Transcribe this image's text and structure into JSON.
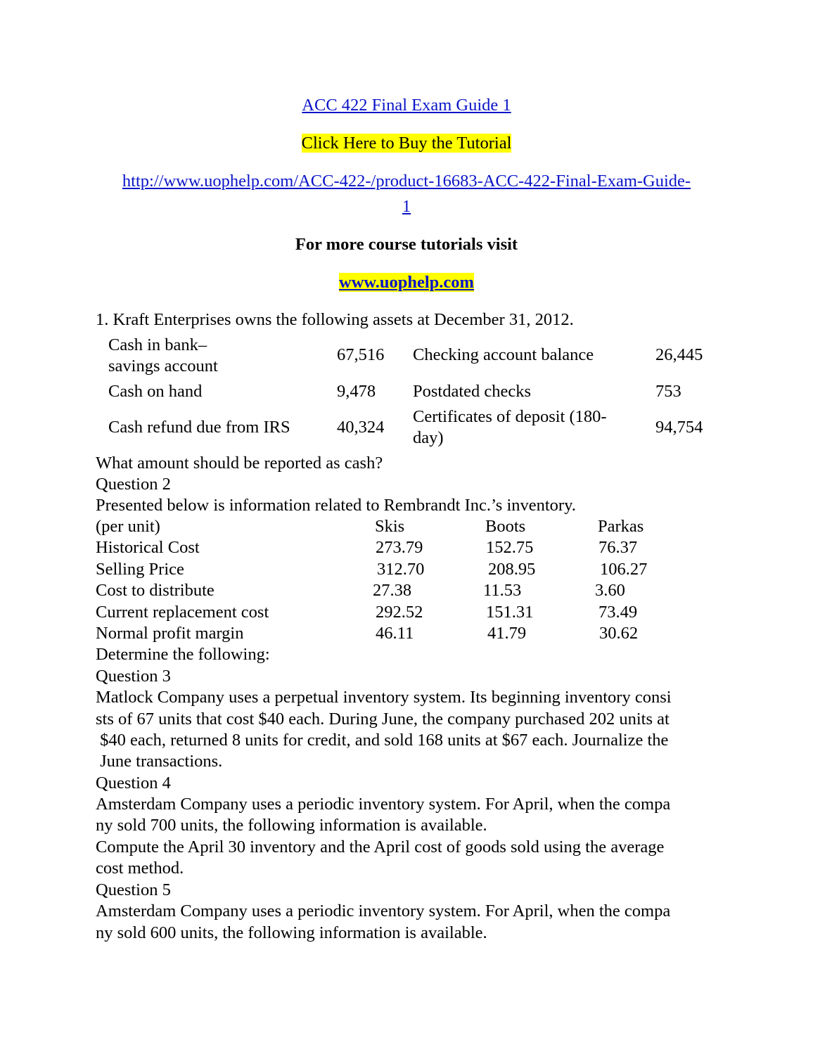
{
  "header": {
    "title_link": "ACC 422 Final Exam Guide 1",
    "buy_label": "Click Here to Buy the Tutorial",
    "url_line1": "http://www.uophelp.com/ACC-422-/product-16683-ACC-422-Final-Exam-Guide-",
    "url_line2": "1",
    "more_text": "For more course tutorials visit",
    "site_link": "www.uophelp.com"
  },
  "q1": {
    "prompt": "1. Kraft Enterprises owns the following assets at December 31, 2012.",
    "rows": [
      {
        "label_a": "Cash in bank–",
        "label_a2": "savings account",
        "value_a": "67,516",
        "label_b": "Checking account balance",
        "label_b2": "",
        "value_b": "26,445"
      },
      {
        "label_a": "Cash on hand",
        "label_a2": "",
        "value_a": "9,478",
        "label_b": "Postdated checks",
        "label_b2": "",
        "value_b": "753"
      },
      {
        "label_a": "Cash refund due from IRS",
        "label_a2": "",
        "value_a": "40,324",
        "label_b": "Certificates of deposit (180-",
        "label_b2": "day)",
        "value_b": "94,754"
      }
    ],
    "question": "What amount should be reported as cash?"
  },
  "q2": {
    "heading": "Question 2",
    "intro": "Presented below is information related to Rembrandt Inc.’s inventory.",
    "columns": [
      "(per unit)",
      "Skis",
      "Boots",
      "Parkas"
    ],
    "rows": [
      [
        "Historical Cost",
        "273.79",
        "152.75",
        "76.37"
      ],
      [
        "Selling Price",
        "312.70",
        "208.95",
        "106.27"
      ],
      [
        "Cost to distribute",
        "27.38",
        "11.53",
        "3.60"
      ],
      [
        "Current replacement cost",
        "292.52",
        "151.31",
        "73.49"
      ],
      [
        "Normal profit margin",
        "46.11",
        "41.79",
        "30.62"
      ]
    ],
    "closing": "Determine the following:"
  },
  "q3": {
    "heading": "Question 3",
    "lines": [
      "Matlock Company uses a perpetual inventory system. Its beginning inventory consi",
      "sts of 67 units that cost $40 each. During June, the company purchased 202 units at",
      " $40 each, returned 8 units for credit, and sold 168 units at $67 each. Journalize the",
      " June transactions."
    ]
  },
  "q4": {
    "heading": "Question 4",
    "lines": [
      "Amsterdam Company uses a periodic inventory system. For April, when the compa",
      "ny sold 700 units, the following information is available.",
      "Compute the April 30 inventory and the April cost of goods sold using the average",
      "cost method."
    ]
  },
  "q5": {
    "heading": "Question 5",
    "lines": [
      "Amsterdam Company uses a periodic inventory system. For April, when the compa",
      "ny sold 600 units, the following information is available."
    ]
  }
}
